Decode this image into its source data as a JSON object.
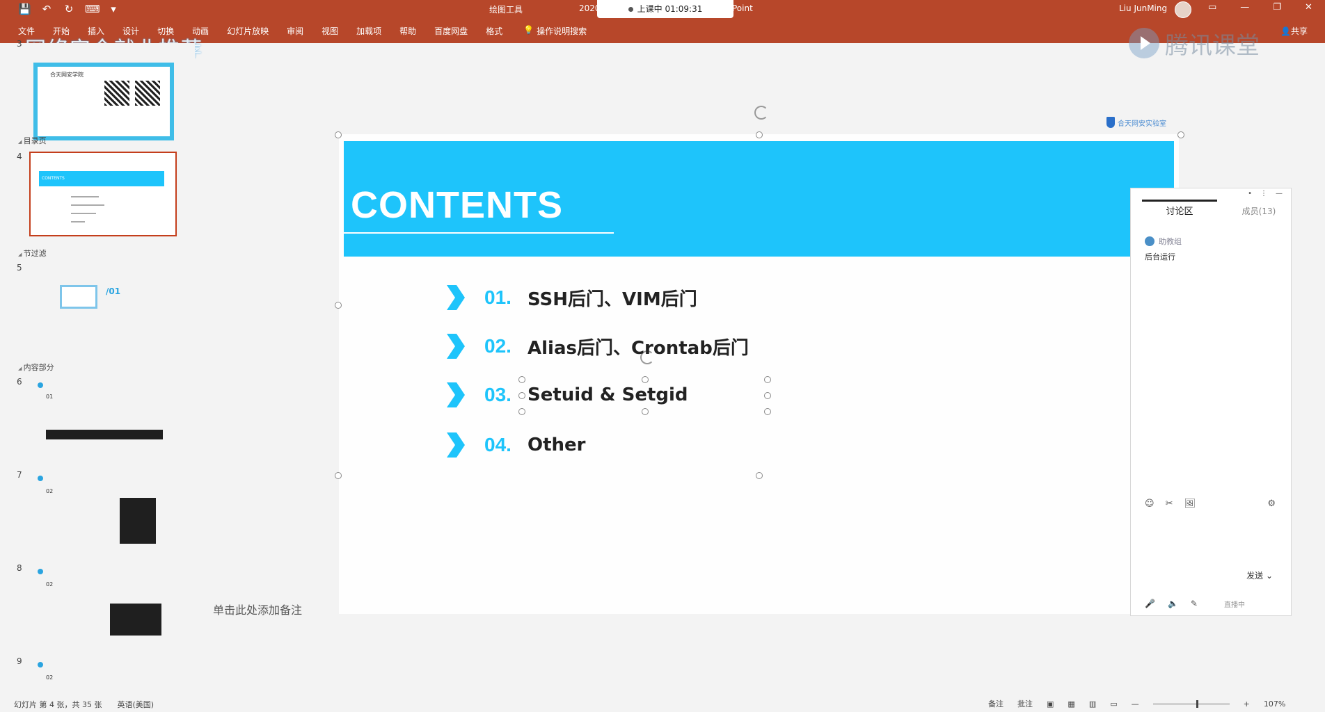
{
  "titlebar": {
    "quick_access": [
      "💾",
      "↶",
      "↻",
      "⌨",
      "▾"
    ],
    "doc_title": "绘图工具",
    "year": "2020",
    "app_name": "Point",
    "timer": "上课中 01:09:31",
    "user_name": "Liu JunMing",
    "window_controls": [
      "▭",
      "—",
      "❐",
      "✕"
    ]
  },
  "ribbon": {
    "tabs": [
      "文件",
      "开始",
      "插入",
      "设计",
      "切换",
      "动画",
      "幻灯片放映",
      "审阅",
      "视图",
      "加载项",
      "帮助",
      "百度网盘",
      "格式"
    ],
    "tell_me": "操作说明搜索",
    "share": "共享"
  },
  "watermarks": {
    "left": "网络安全就业推荐",
    "right": "腾讯课堂"
  },
  "thumbpane": {
    "sections": [
      "目录页",
      "节过滤",
      "内容部分"
    ],
    "slide_numbers": [
      "3",
      "4",
      "5",
      "6",
      "7",
      "8",
      "9"
    ],
    "thumb3_title": "合天网安学院",
    "thumb4_title": "CONTENTS",
    "thumb5_num": "/01",
    "thumb6_num": "01",
    "thumb7_num": "02",
    "thumb8_num": "02",
    "thumb9_num": "02"
  },
  "notes_prompt": "单击此处添加备注",
  "slide": {
    "title": "CONTENTS",
    "logo_text": "合天网安实验室",
    "items": [
      {
        "num": "01.",
        "text": "SSH后门、VIM后门"
      },
      {
        "num": "02.",
        "text": "Alias后门、Crontab后门"
      },
      {
        "num": "03.",
        "text": "Setuid & Setgid"
      },
      {
        "num": "04.",
        "text": "Other"
      }
    ]
  },
  "discussion": {
    "top_icons": [
      "•",
      "⋮",
      "—"
    ],
    "tab_active": "讨论区",
    "tab_other": "成员(13)",
    "msg_user": "助教组",
    "msg_text": "后台运行",
    "tool_icons": [
      "☺",
      "✂",
      "🖼"
    ],
    "settings_icon": "⚙",
    "send": "发送 ⌄",
    "bottom_icons": [
      "🎤",
      "🔈",
      "✎"
    ],
    "bottom_text": "直播中"
  },
  "statusbar": {
    "slide_info": "幻灯片 第 4 张，共 35 张",
    "lang": "英语(美国)",
    "notes": "备注",
    "comments": "批注",
    "zoom": "107%",
    "minus": "—",
    "plus": "+"
  },
  "colors": {
    "ribbon": "#b7472a",
    "banner": "#1ec4fb",
    "accent_num": "#1ec4fb"
  }
}
